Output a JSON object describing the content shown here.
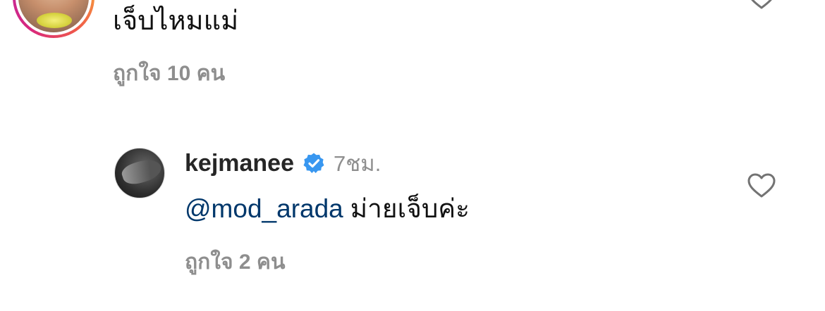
{
  "parent_comment": {
    "text": "เจ็บไหมแม่",
    "likes": "ถูกใจ 10 คน",
    "like_icon": "heart-outline-icon"
  },
  "reply": {
    "username": "kejmanee",
    "verified_icon": "verified-badge-icon",
    "timestamp": "7ชม.",
    "mention": "@mod_arada",
    "text": "ม่ายเจ็บค่ะ",
    "likes": "ถูกใจ 2 คน",
    "like_icon": "heart-outline-icon"
  },
  "colors": {
    "mention": "#00376b",
    "muted": "#8e8e8e",
    "verified": "#3897f0",
    "text": "#111111"
  }
}
